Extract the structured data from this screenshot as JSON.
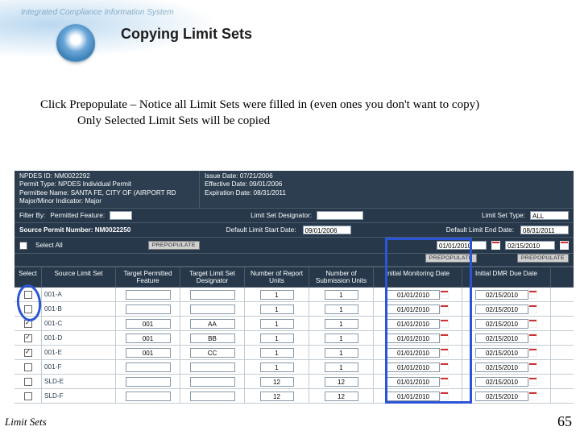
{
  "header": {
    "system": "Integrated Compliance Information System",
    "title": "Copying Limit Sets"
  },
  "body": {
    "line1": "Click Prepopulate – Notice all Limit Sets were filled in (even ones you don't want to copy)",
    "line2": "Only Selected Limit Sets will be copied"
  },
  "app": {
    "meta_left": {
      "l1": "NPDES ID: NM0022292",
      "l2": "Permit Type: NPDES Individual Permit",
      "l3": "Permittee Name: SANTA FE, CITY OF (AIRPORT RD",
      "l4": "Major/Minor Indicator: Major"
    },
    "meta_right": {
      "l1": "Issue Date: 07/21/2006",
      "l2": "Effective Date: 09/01/2006",
      "l3": "Expiration Date: 08/31/2011"
    },
    "filter": {
      "label": "Filter By:",
      "pf_label": "Permitted Feature:",
      "lsd_label": "Limit Set Designator:",
      "lst_label": "Limit Set Type:",
      "lst_value": "ALL"
    },
    "defaults": {
      "spn_label": "Source Permit Number: NM0022250",
      "dls_label": "Default Limit Start Date:",
      "dls_value": "09/01/2006",
      "dle_label": "Default Limit End Date:",
      "dle_value": "08/31/2011"
    },
    "seltools": {
      "select_all": "Select All",
      "prepop": "PREPOPULATE",
      "preset_imd": "01/01/2010",
      "preset_idd": "02/15/2010"
    },
    "columns": {
      "sel": "Select",
      "src": "Source Limit Set",
      "tpf": "Target Permitted Feature",
      "tlsd": "Target Limit Set Designator",
      "nru": "Number of Report Units",
      "nsu": "Number of Submission Units",
      "imd": "Initial Monitoring Date",
      "idd": "Initial DMR Due Date"
    },
    "rows": [
      {
        "checked": false,
        "src": "001-A",
        "tpf": "",
        "tlsd": "",
        "nru": "1",
        "nsu": "1",
        "imd": "01/01/2010",
        "idd": "02/15/2010"
      },
      {
        "checked": false,
        "src": "001-B",
        "tpf": "",
        "tlsd": "",
        "nru": "1",
        "nsu": "1",
        "imd": "01/01/2010",
        "idd": "02/15/2010"
      },
      {
        "checked": true,
        "src": "001-C",
        "tpf": "001",
        "tlsd": "AA",
        "nru": "1",
        "nsu": "1",
        "imd": "01/01/2010",
        "idd": "02/15/2010"
      },
      {
        "checked": true,
        "src": "001-D",
        "tpf": "001",
        "tlsd": "BB",
        "nru": "1",
        "nsu": "1",
        "imd": "01/01/2010",
        "idd": "02/15/2010"
      },
      {
        "checked": true,
        "src": "001-E",
        "tpf": "001",
        "tlsd": "CC",
        "nru": "1",
        "nsu": "1",
        "imd": "01/01/2010",
        "idd": "02/15/2010"
      },
      {
        "checked": false,
        "src": "001-F",
        "tpf": "",
        "tlsd": "",
        "nru": "1",
        "nsu": "1",
        "imd": "01/01/2010",
        "idd": "02/15/2010"
      },
      {
        "checked": false,
        "src": "SLD-E",
        "tpf": "",
        "tlsd": "",
        "nru": "12",
        "nsu": "12",
        "imd": "01/01/2010",
        "idd": "02/15/2010"
      },
      {
        "checked": false,
        "src": "SLD-F",
        "tpf": "",
        "tlsd": "",
        "nru": "12",
        "nsu": "12",
        "imd": "01/01/2010",
        "idd": "02/15/2010"
      }
    ]
  },
  "footer": {
    "left": "Limit Sets",
    "right": "65"
  }
}
